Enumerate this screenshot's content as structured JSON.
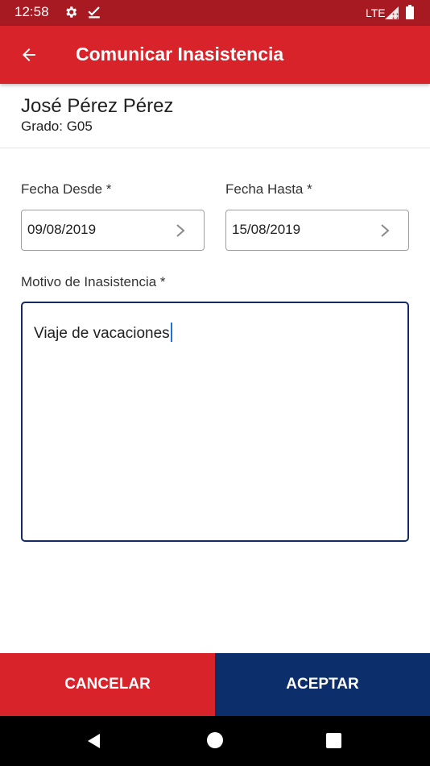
{
  "status_bar": {
    "time": "12:58",
    "network": "LTE",
    "icons": [
      "gear-icon",
      "check-icon",
      "signal-icon",
      "battery-icon"
    ]
  },
  "app_bar": {
    "title": "Comunicar Inasistencia",
    "back_icon": "arrow-left-icon"
  },
  "student": {
    "name": "José Pérez Pérez",
    "grade": "Grado: G05"
  },
  "form": {
    "fecha_desde": {
      "label": "Fecha Desde *",
      "value": "09/08/2019"
    },
    "fecha_hasta": {
      "label": "Fecha Hasta *",
      "value": "15/08/2019"
    },
    "motivo": {
      "label": "Motivo de Inasistencia *",
      "value": "Viaje de vacaciones"
    }
  },
  "actions": {
    "cancel": "CANCELAR",
    "accept": "ACEPTAR"
  },
  "colors": {
    "status_bar": "#a71a22",
    "primary_red": "#d8232a",
    "primary_navy": "#0c2e6b",
    "focus_border": "#142a60",
    "caret": "#1e6fe0"
  }
}
